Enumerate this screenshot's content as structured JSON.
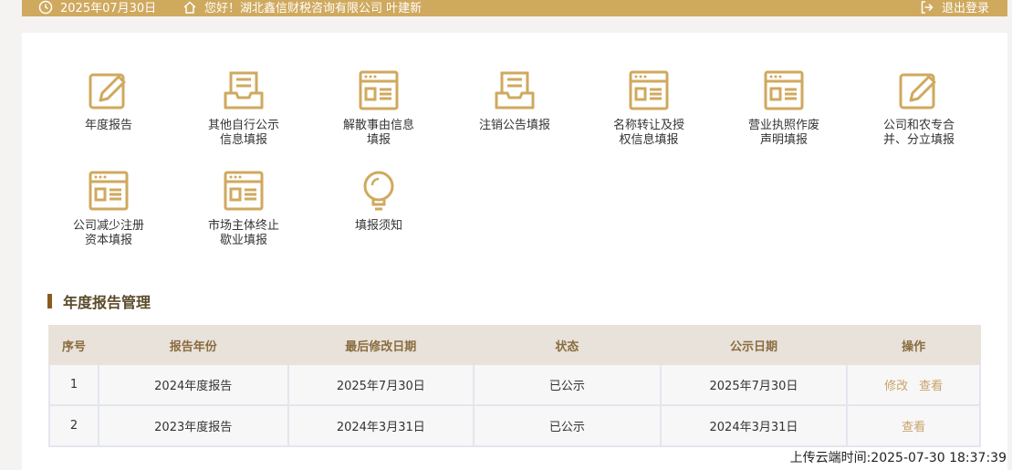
{
  "topbar": {
    "date": "2025年07月30日",
    "greeting": "您好！湖北鑫信财税咨询有限公司 叶建新",
    "logout": "退出登录",
    "accent": "#cfa95e"
  },
  "tiles": [
    {
      "label": "年度报告",
      "icon": "edit-icon"
    },
    {
      "label": "其他自行公示\n信息填报",
      "icon": "document-tray-icon"
    },
    {
      "label": "解散事由信息\n填报",
      "icon": "browser-form-icon"
    },
    {
      "label": "注销公告填报",
      "icon": "document-tray-icon"
    },
    {
      "label": "名称转让及授\n权信息填报",
      "icon": "browser-form-icon"
    },
    {
      "label": "营业执照作废\n声明填报",
      "icon": "browser-form-icon"
    },
    {
      "label": "公司和农专合\n并、分立填报",
      "icon": "edit-icon"
    },
    {
      "label": "公司减少注册\n资本填报",
      "icon": "browser-form-icon"
    },
    {
      "label": "市场主体终止\n歇业填报",
      "icon": "browser-form-icon"
    },
    {
      "label": "填报须知",
      "icon": "lightbulb-icon"
    }
  ],
  "section_title": "年度报告管理",
  "table": {
    "headers": [
      "序号",
      "报告年份",
      "最后修改日期",
      "状态",
      "公示日期",
      "操作"
    ],
    "rows": [
      {
        "no": "1",
        "year": "2024年度报告",
        "modified": "2025年7月30日",
        "status": "已公示",
        "published": "2025年7月30日",
        "actions": [
          "修改",
          "查看"
        ]
      },
      {
        "no": "2",
        "year": "2023年度报告",
        "modified": "2024年3月31日",
        "status": "已公示",
        "published": "2024年3月31日",
        "actions": [
          "查看"
        ]
      }
    ]
  },
  "footer": {
    "upload_time": "上传云端时间:2025-07-30 18:37:39"
  }
}
